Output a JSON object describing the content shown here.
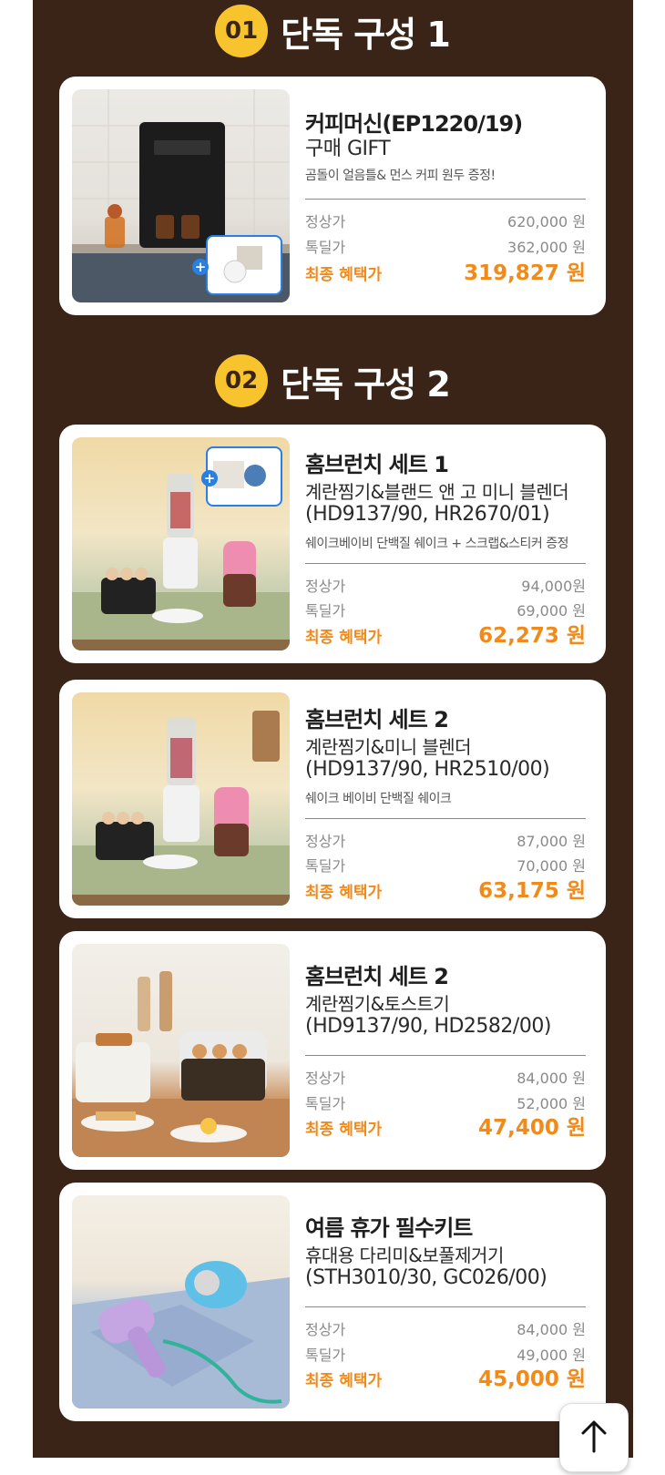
{
  "sections": [
    {
      "number": "01",
      "title": "단독 구성 1"
    },
    {
      "number": "02",
      "title": "단독 구성 2"
    }
  ],
  "labels": {
    "regular": "정상가",
    "special": "톡딜가",
    "final": "최종 혜택가"
  },
  "products": [
    {
      "name": "커피머신(EP1220/19)",
      "lines": [
        "구매 GIFT"
      ],
      "note": "곰돌이 얼음틀& 먼스 커피 원두 증정!",
      "regular_price": "620,000 원",
      "special_price": "362,000 원",
      "final_price": "319,827 원"
    },
    {
      "name": "홈브런치 세트 1",
      "lines": [
        "계란찜기&블랜드 앤 고 미니 블렌더",
        "(HD9137/90, HR2670/01)"
      ],
      "note": "쉐이크베이비 단백질 쉐이크 + 스크랩&스티커 증정",
      "regular_price": "94,000원",
      "special_price": "69,000 원",
      "final_price": "62,273 원"
    },
    {
      "name": "홈브런치 세트 2",
      "lines": [
        "계란찜기&미니 블렌더",
        "(HD9137/90, HR2510/00)"
      ],
      "note": "쉐이크 베이비 단백질 쉐이크",
      "regular_price": "87,000 원",
      "special_price": "70,000 원",
      "final_price": "63,175 원"
    },
    {
      "name": "홈브런치 세트 2",
      "lines": [
        "계란찜기&토스트기",
        "(HD9137/90, HD2582/00)"
      ],
      "note": "",
      "regular_price": "84,000 원",
      "special_price": "52,000 원",
      "final_price": "47,400 원"
    },
    {
      "name": "여름 휴가 필수키트",
      "lines": [
        "휴대용 다리미&보풀제거기",
        "(STH3010/30, GC026/00)"
      ],
      "note": "",
      "regular_price": "84,000 원",
      "special_price": "49,000 원",
      "final_price": "45,000 원"
    }
  ],
  "scroll_top": {
    "icon": "arrow-up-icon"
  }
}
